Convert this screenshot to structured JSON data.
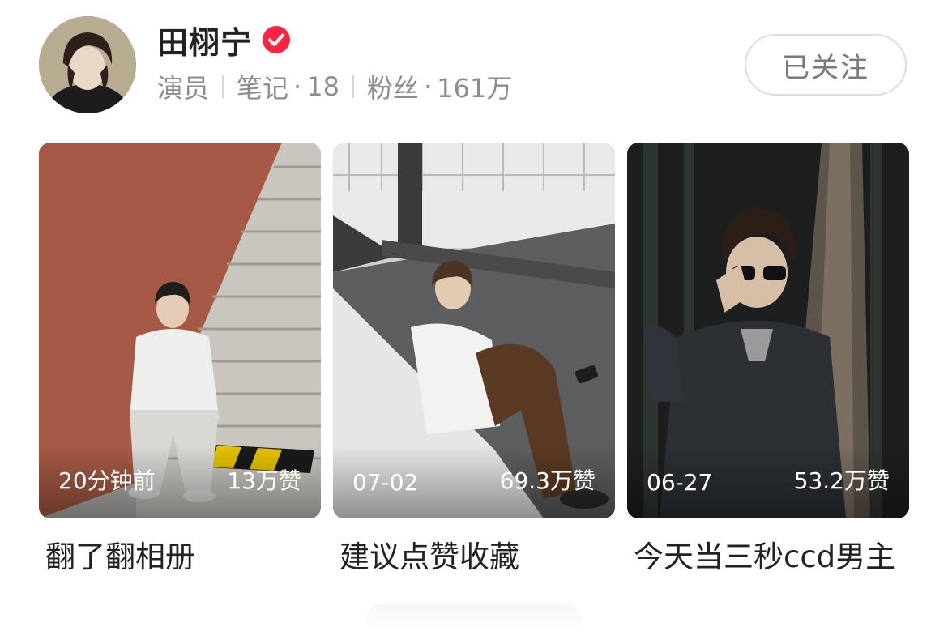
{
  "profile": {
    "name": "田栩宁",
    "verified_icon": "verified-check-icon",
    "role": "演员",
    "notes_label": "笔记",
    "notes_count": "18",
    "fans_label": "粉丝",
    "fans_count": "161万",
    "dot": "·"
  },
  "follow_button": {
    "label": "已关注"
  },
  "posts": [
    {
      "time": "20分钟前",
      "likes": "13万赞",
      "title": "翻了翻相册"
    },
    {
      "time": "07-02",
      "likes": "69.3万赞",
      "title": "建议点赞收藏"
    },
    {
      "time": "06-27",
      "likes": "53.2万赞",
      "title": "今天当三秒ccd男主"
    }
  ],
  "colors": {
    "verified": "#ff2442",
    "meta_text": "#8d8d8d",
    "follow_border": "#dddddd"
  }
}
